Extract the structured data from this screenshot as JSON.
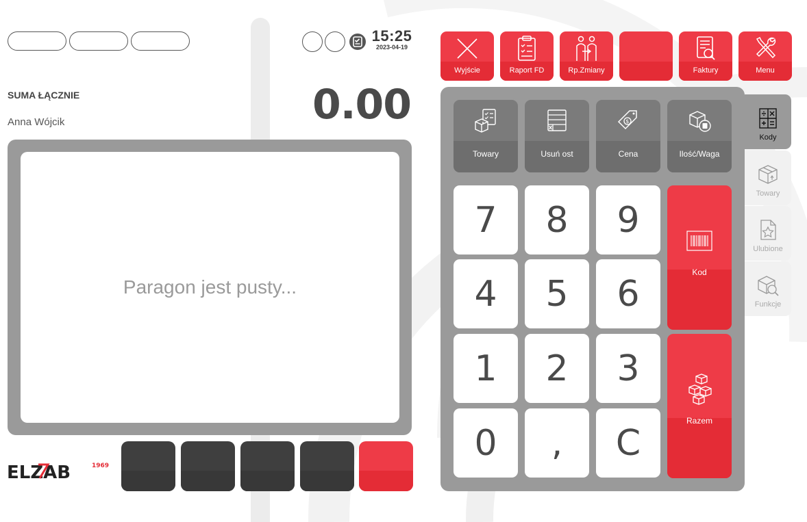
{
  "status": {
    "time": "15:25",
    "date": "2023-04-19"
  },
  "summary": {
    "label": "SUMA ŁĄCZNIE",
    "cashier": "Anna Wójcik",
    "total": "0.00"
  },
  "receipt": {
    "empty_message": "Paragon jest pusty..."
  },
  "toolbar": {
    "items": [
      {
        "label": "Wyjście",
        "icon": "close-icon"
      },
      {
        "label": "Raport FD",
        "icon": "clipboard-report-icon"
      },
      {
        "label": "Rp.Zmiany",
        "icon": "shift-change-people-icon"
      },
      {
        "label": "",
        "icon": ""
      },
      {
        "label": "Faktury",
        "icon": "invoice-search-icon"
      },
      {
        "label": "Menu",
        "icon": "wrench-screwdriver-icon"
      }
    ]
  },
  "functions": {
    "items": [
      {
        "label": "Towary",
        "icon": "box-checklist-icon"
      },
      {
        "label": "Usuń ost",
        "icon": "list-delete-icon"
      },
      {
        "label": "Cena",
        "icon": "price-tag-icon"
      },
      {
        "label": "Ilość/Waga",
        "icon": "box-scale-icon"
      }
    ]
  },
  "keypad": {
    "keys": [
      "7",
      "8",
      "9",
      "4",
      "5",
      "6",
      "1",
      "2",
      "3",
      "0",
      ",",
      "C"
    ],
    "code_label": "Kod",
    "total_label": "Razem"
  },
  "side_tabs": {
    "items": [
      {
        "label": "Kody",
        "icon": "calculator-icon",
        "active": true
      },
      {
        "label": "Towary",
        "icon": "box-icon",
        "active": false
      },
      {
        "label": "Ulubione",
        "icon": "favorite-file-icon",
        "active": false
      },
      {
        "label": "Funkcje",
        "icon": "box-search-icon",
        "active": false
      }
    ]
  },
  "brand": {
    "name": "ELZAB",
    "year": "1969"
  },
  "colors": {
    "accent_red": "#ee3b47",
    "dark_red": "#e42c36",
    "panel_gray": "#9a9a9a",
    "dark_button": "#3f3f3f"
  }
}
